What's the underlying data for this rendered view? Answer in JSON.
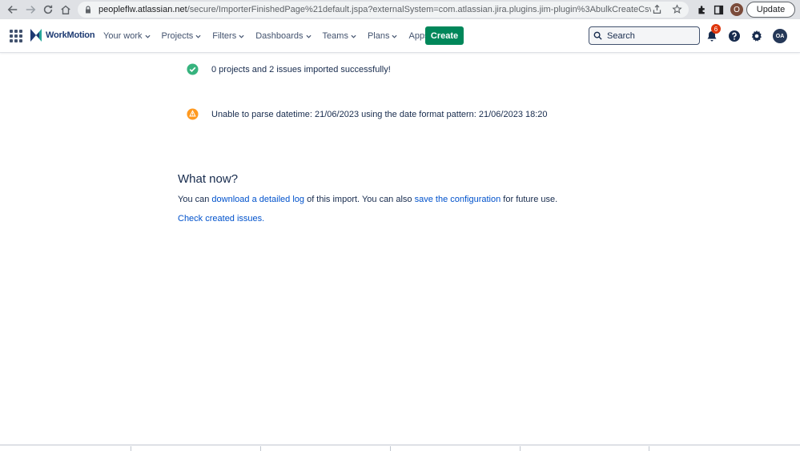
{
  "browser": {
    "url_host": "peopleflw.atlassian.net",
    "url_path": "/secure/ImporterFinishedPage%21default.jspa?externalSystem=com.atlassian.jira.plugins.jim-plugin%3AbulkCreateCsv&atl_to...",
    "profile_initial": "O",
    "update_label": "Update"
  },
  "header": {
    "logo_text": "WorkMotion",
    "nav": [
      {
        "label": "Your work"
      },
      {
        "label": "Projects"
      },
      {
        "label": "Filters"
      },
      {
        "label": "Dashboards"
      },
      {
        "label": "Teams"
      },
      {
        "label": "Plans"
      },
      {
        "label": "Apps"
      }
    ],
    "create_label": "Create",
    "search_placeholder": "Search",
    "notification_count": "6",
    "avatar_initials": "OA"
  },
  "main": {
    "success_message": "0 projects and 2 issues imported successfully!",
    "warning_message": "Unable to parse datetime: 21/06/2023 using the date format pattern: 21/06/2023 18:20",
    "what_now_heading": "What now?",
    "para1_prefix": "You can ",
    "para1_link1": "download a detailed log",
    "para1_middle": " of this import. You can also ",
    "para1_link2": "save the configuration",
    "para1_suffix": " for future use.",
    "check_issues_link": "Check created issues."
  },
  "colors": {
    "success": "#36b37e",
    "warning": "#ff991f",
    "create": "#00875a",
    "link": "#0052cc"
  }
}
